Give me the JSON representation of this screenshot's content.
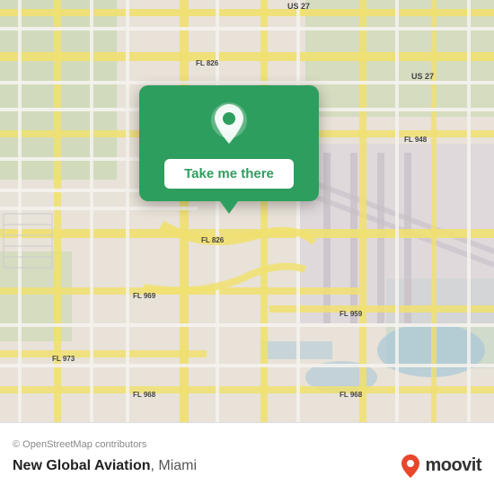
{
  "map": {
    "attribution": "© OpenStreetMap contributors",
    "background_color": "#e8e0d8"
  },
  "popup": {
    "button_label": "Take me there",
    "icon": "location-pin-icon"
  },
  "bottom_bar": {
    "place_name": "New Global Aviation",
    "place_city": "Miami",
    "attribution": "© OpenStreetMap contributors"
  },
  "moovit": {
    "logo_text": "moovit",
    "pin_color": "#e8472b"
  }
}
